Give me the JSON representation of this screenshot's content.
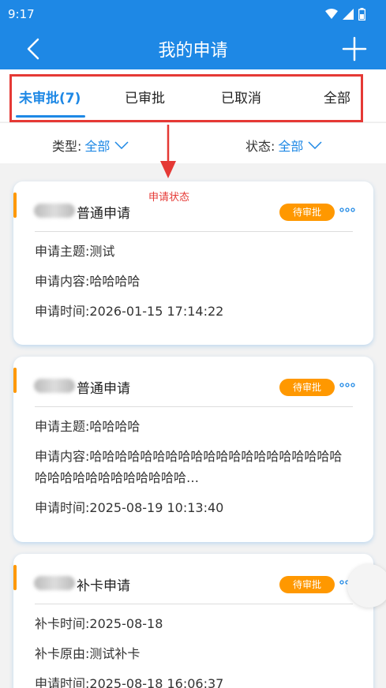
{
  "status_bar": {
    "time": "9:17",
    "icons": [
      "wifi-icon",
      "signal-icon",
      "battery-icon"
    ]
  },
  "app_bar": {
    "title": "我的申请",
    "back_icon": "chevron-left-icon",
    "add_icon": "plus-icon"
  },
  "tabs": [
    {
      "label": "未审批(7)",
      "active": true
    },
    {
      "label": "已审批",
      "active": false
    },
    {
      "label": "已取消",
      "active": false
    },
    {
      "label": "全部",
      "active": false
    }
  ],
  "filters": {
    "type": {
      "label": "类型:",
      "value": "全部"
    },
    "status": {
      "label": "状态:",
      "value": "全部"
    }
  },
  "annotation": {
    "text": "申请状态",
    "color": "#e53935"
  },
  "cards": [
    {
      "title": "普通申请",
      "badge": "待审批",
      "rows": [
        "申请主题:测试",
        "申请内容:哈哈哈哈",
        "申请时间:2026-01-15 17:14:22"
      ]
    },
    {
      "title": "普通申请",
      "badge": "待审批",
      "rows": [
        "申请主题:哈哈哈哈",
        "申请内容:哈哈哈哈哈哈哈哈哈哈哈哈哈哈哈哈哈哈哈哈哈哈哈哈哈哈哈哈哈哈哈哈…",
        "申请时间:2025-08-19 10:13:40"
      ]
    },
    {
      "title": "补卡申请",
      "badge": "待审批",
      "rows": [
        "补卡时间:2025-08-18",
        "补卡原由:测试补卡",
        "申请时间:2025-08-18 16:06:37"
      ]
    }
  ],
  "colors": {
    "primary": "#1e88e5",
    "badge": "#ff9800",
    "annotation": "#e53935"
  }
}
